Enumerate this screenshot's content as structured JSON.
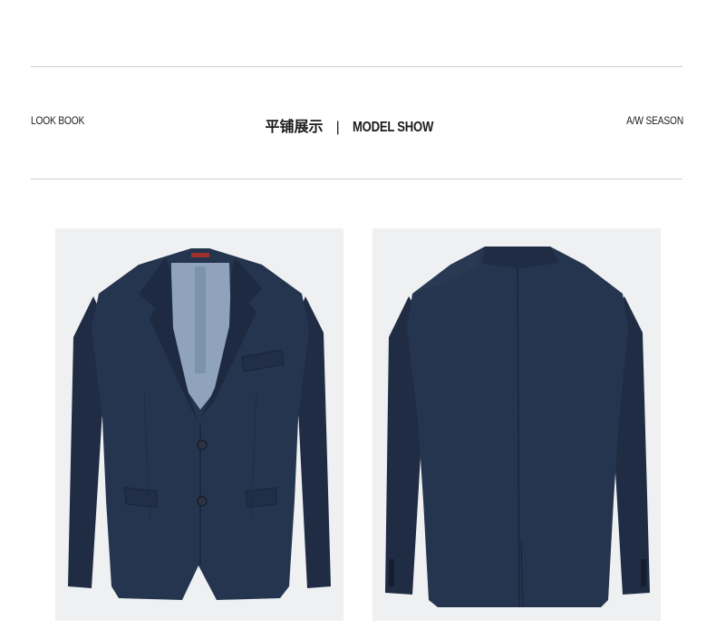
{
  "header": {
    "left_label": "LOOK BOOK",
    "center_cn": "平铺展示",
    "separator": "|",
    "center_en": "MODEL SHOW",
    "right_label": "A/W SEASON"
  },
  "images": [
    {
      "name": "jacket-front-photo",
      "description": "navy blazer front view"
    },
    {
      "name": "jacket-back-photo",
      "description": "navy blazer back view"
    }
  ],
  "colors": {
    "navy": "#26354f",
    "navy_dark": "#1a253a",
    "lining": "#8fa3bd",
    "photo_bg": "#eef0f2",
    "rule": "#cfcfcf"
  }
}
